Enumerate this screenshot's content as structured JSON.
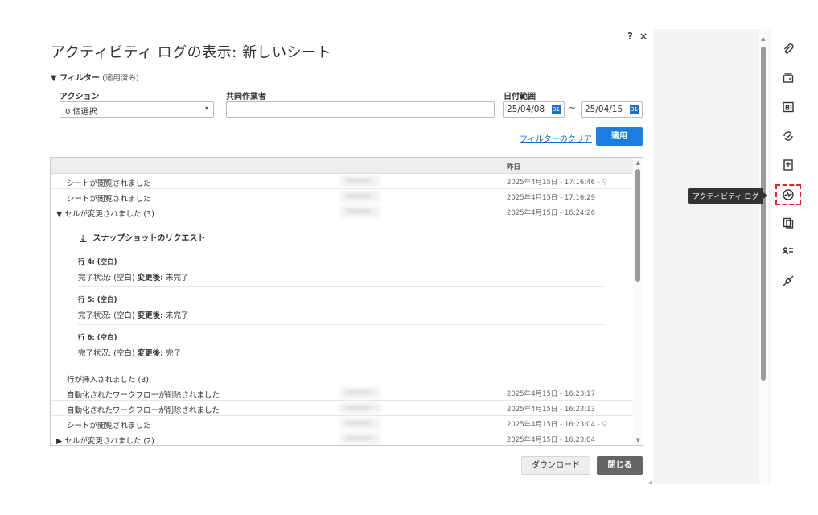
{
  "dialog": {
    "help_label": "?",
    "close_label": "×",
    "title": "アクティビティ ログの表示: 新しいシート",
    "filter_toggle": "▼ フィルター",
    "filter_state": "(適用済み)",
    "action_label": "アクション",
    "action_value": "0 個選択",
    "collaborator_label": "共同作業者",
    "collaborator_value": "",
    "date_range_label": "日付範囲",
    "date_from": "25/04/08",
    "date_to": "25/04/15",
    "tilde": "~",
    "clear_filter": "フィルターのクリア",
    "apply": "適用",
    "download": "ダウンロード",
    "close": "閉じる"
  },
  "log": {
    "column_header": "昨日",
    "rows_top": [
      {
        "text": "シートが閲覧されました",
        "time": "2025年4月15日 - 17:16:46 -",
        "has_link": true
      },
      {
        "text": "シートが閲覧されました",
        "time": "2025年4月15日 - 17:16:29",
        "has_link": false
      },
      {
        "text": "▼ セルが変更されました (3)",
        "time": "2025年4月15日 - 16:24:26",
        "has_link": false
      }
    ],
    "snapshot_request": "スナップショットのリクエスト",
    "details": [
      {
        "heading": "行 4: (空白)",
        "prefix": "完了状況: (空白)",
        "after_label": "変更後:",
        "after_value": "未完了"
      },
      {
        "heading": "行 5: (空白)",
        "prefix": "完了状況: (空白)",
        "after_label": "変更後:",
        "after_value": "未完了"
      },
      {
        "heading": "行 6: (空白)",
        "prefix": "完了状況: (空白)",
        "after_label": "変更後:",
        "after_value": "完了"
      }
    ],
    "inserted_rows": "行が挿入されました (3)",
    "rows_bottom": [
      {
        "text": "自動化されたワークフローが削除されました",
        "time": "2025年4月15日 - 16:23:17",
        "has_link": false
      },
      {
        "text": "自動化されたワークフローが削除されました",
        "time": "2025年4月15日 - 16:23:13",
        "has_link": false
      },
      {
        "text": "シートが閲覧されました",
        "time": "2025年4月15日 - 16:23:04 -",
        "has_link": true
      },
      {
        "text": "▶ セルが変更されました (2)",
        "time": "2025年4月15日 - 16:23:04",
        "has_link": false
      }
    ]
  },
  "rail": {
    "tooltip": "アクティビティ ログ",
    "icons": [
      "attachment-icon",
      "comments-icon",
      "brandfolder-icon",
      "sheet-summary-icon",
      "publish-icon",
      "activity-log-icon",
      "proofing-icon",
      "workspace-sharing-icon",
      "connections-icon"
    ]
  },
  "colors": {
    "accent_blue": "#1a7fe0",
    "close_button": "#666666",
    "highlight_border": "#ee2222"
  }
}
